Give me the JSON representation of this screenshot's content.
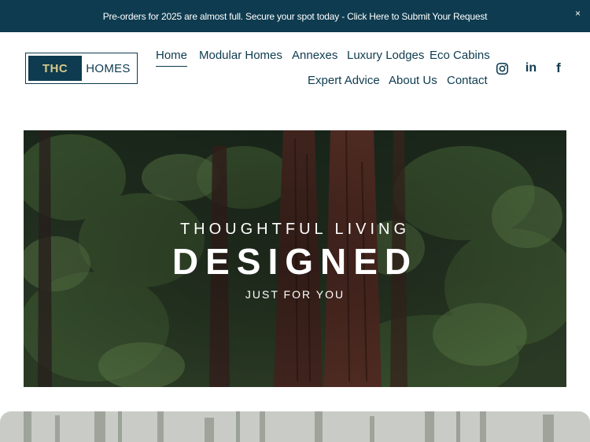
{
  "announcement": {
    "text": "Pre-orders for 2025 are almost full. Secure your spot today - Click Here to Submit Your Request",
    "close_glyph": "×"
  },
  "logo": {
    "mark": "THC",
    "word": "HOMES"
  },
  "nav": {
    "items": [
      {
        "label": "Home",
        "active": true
      },
      {
        "label": "Modular Homes"
      },
      {
        "label": "Annexes"
      },
      {
        "label": "Luxury Lodges"
      },
      {
        "label": "Eco Cabins"
      },
      {
        "label": "Expert Advice"
      },
      {
        "label": "About Us"
      },
      {
        "label": "Contact"
      }
    ]
  },
  "social": {
    "icons": [
      "instagram-icon",
      "linkedin-icon",
      "facebook-icon"
    ],
    "linkedin_glyph": "in",
    "facebook_glyph": "f"
  },
  "hero": {
    "eyebrow": "THOUGHTFUL LIVING",
    "title": "DESIGNED",
    "subtitle": "JUST FOR YOU"
  },
  "colors": {
    "brand_navy": "#0e3b4f",
    "logo_gold": "#d7c98a",
    "white": "#ffffff"
  }
}
